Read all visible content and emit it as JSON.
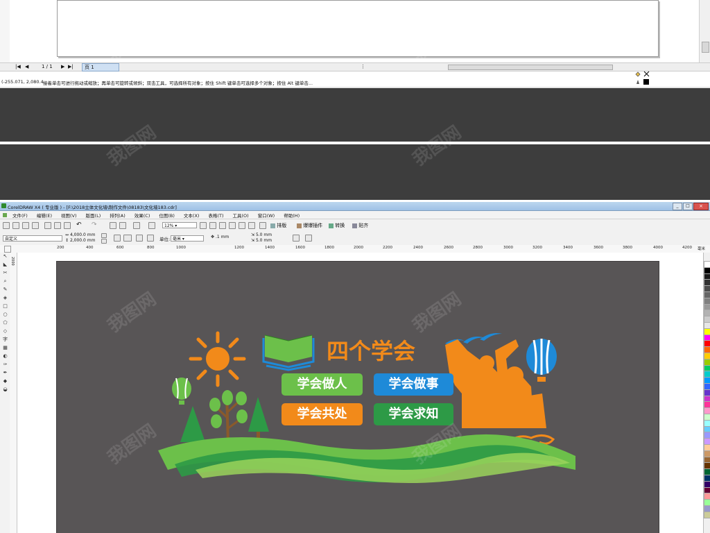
{
  "top_window": {
    "page_counter": "1 / 1",
    "page_tab": "页 1",
    "status_coords": "(-255.071, 2,080.4...",
    "status_hint": "接着单击可进行拖动或缩放；再单击可旋转或倾斜；双击工具，可选择所有对象；按住 Shift 键单击可选择多个对象；按住 Alt 键单击..."
  },
  "window": {
    "title": "CorelDRAW X4 ( 专业版 ) - [F:\\2018立体文化墙\\制作文件\\08183\\文化墙183.cdr]",
    "controls": [
      "_",
      "□",
      "×"
    ]
  },
  "menu": [
    "文件(F)",
    "编辑(E)",
    "视图(V)",
    "版面(L)",
    "排列(A)",
    "效果(C)",
    "位图(B)",
    "文本(X)",
    "表格(T)",
    "工具(O)",
    "窗口(W)",
    "帮助(H)"
  ],
  "toolbar": {
    "zoom": "12%",
    "plugins": [
      "排版",
      "爆爆插件",
      "转换",
      "贴齐"
    ]
  },
  "property_bar": {
    "preset": "自定义",
    "width": "4,000.0 mm",
    "height": "2,000.0 mm",
    "unit_label": "单位:",
    "unit": "毫米",
    "nudge": ".1 mm",
    "dup_x": "5.0 mm",
    "dup_y": "5.0 mm"
  },
  "ruler": {
    "ticks": [
      "200",
      "400",
      "600",
      "800",
      "1000",
      "1200",
      "1400",
      "1600",
      "1800",
      "2000",
      "2200",
      "2400",
      "2600",
      "2800",
      "3000",
      "3200",
      "3400",
      "3600",
      "3800",
      "4000",
      "4200"
    ],
    "unit": "毫米",
    "v_label": "2000"
  },
  "design": {
    "title": "四个学会",
    "pills": [
      "学会做人",
      "学会做事",
      "学会共处",
      "学会求知"
    ]
  },
  "colors": {
    "orange": "#f28a1a",
    "green": "#6cc04a",
    "blue": "#1e8ad8",
    "dark_green": "#2d9a46",
    "board": "#585556",
    "dark_band": "#3d3d3d"
  },
  "watermark_text": "我图网"
}
